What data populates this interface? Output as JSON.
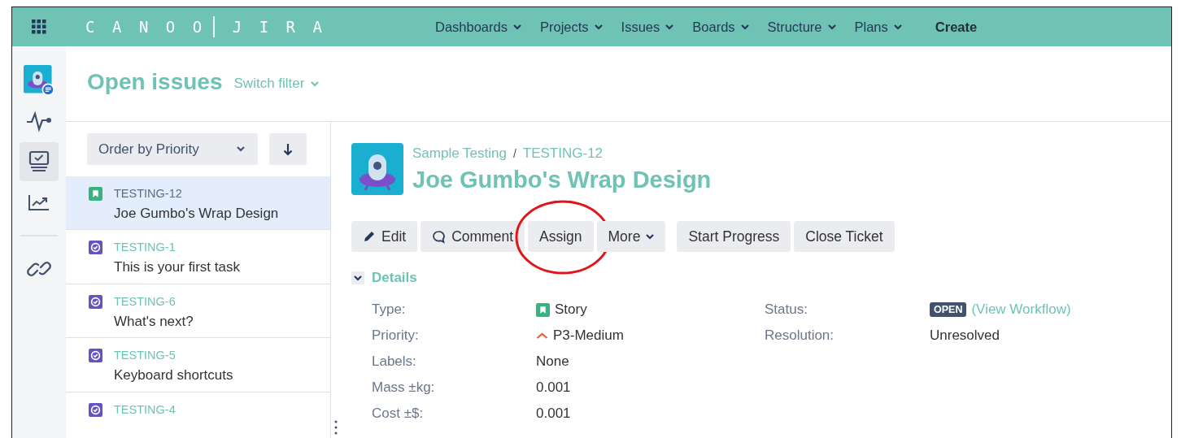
{
  "topbar": {
    "logo_left": "CANOO",
    "logo_right": "JIRA",
    "menus": [
      {
        "label": "Dashboards"
      },
      {
        "label": "Projects"
      },
      {
        "label": "Issues"
      },
      {
        "label": "Boards"
      },
      {
        "label": "Structure"
      },
      {
        "label": "Plans"
      }
    ],
    "create": "Create"
  },
  "sidebar": {
    "items": [
      {
        "kind": "avatar",
        "selected": false
      },
      {
        "kind": "pulse",
        "selected": false
      },
      {
        "kind": "board",
        "selected": true
      },
      {
        "kind": "chart",
        "selected": false
      },
      {
        "kind": "divider"
      },
      {
        "kind": "link",
        "selected": false
      }
    ]
  },
  "filter": {
    "title": "Open issues",
    "switch": "Switch filter"
  },
  "list": {
    "order": "Order by Priority",
    "issues": [
      {
        "key": "TESTING-12",
        "summary": "Joe Gumbo's Wrap Design",
        "kind": "story",
        "selected": true
      },
      {
        "key": "TESTING-1",
        "summary": "This is your first task",
        "kind": "task",
        "selected": false
      },
      {
        "key": "TESTING-6",
        "summary": "What's next?",
        "kind": "task",
        "selected": false
      },
      {
        "key": "TESTING-5",
        "summary": "Keyboard shortcuts",
        "kind": "task",
        "selected": false
      },
      {
        "key": "TESTING-4",
        "kind": "task",
        "selected": false
      }
    ]
  },
  "issue": {
    "project": "Sample Testing",
    "separator": "/",
    "key": "TESTING-12",
    "title": "Joe Gumbo's Wrap Design",
    "actions": [
      {
        "label": "Edit",
        "kind": "edit",
        "circled": false
      },
      {
        "label": "Comment",
        "kind": "comment",
        "circled": false
      },
      {
        "label": "Assign",
        "kind": "plain",
        "circled": true
      },
      {
        "label": "More",
        "kind": "dropdown",
        "circled": false
      },
      {
        "label": "Start Progress",
        "kind": "workflow",
        "circled": false
      },
      {
        "label": "Close Ticket",
        "kind": "plain",
        "circled": false
      }
    ],
    "section": {
      "label": "Details",
      "expanded": true
    },
    "fields_left": [
      {
        "label": "Type:",
        "value": "Story",
        "kind": "story"
      },
      {
        "label": "Priority:",
        "value": "P3-Medium",
        "kind": "priority"
      },
      {
        "label": "Labels:",
        "value": "None",
        "kind": "text"
      },
      {
        "label": "Mass ±kg:",
        "value": "0.001",
        "kind": "text"
      },
      {
        "label": "Cost ±$:",
        "value": "0.001",
        "kind": "text"
      }
    ],
    "fields_right": [
      {
        "label": "Status:",
        "badge": "OPEN",
        "link": "(View Workflow)",
        "kind": "status"
      },
      {
        "label": "Resolution:",
        "value": "Unresolved",
        "kind": "text"
      }
    ]
  }
}
